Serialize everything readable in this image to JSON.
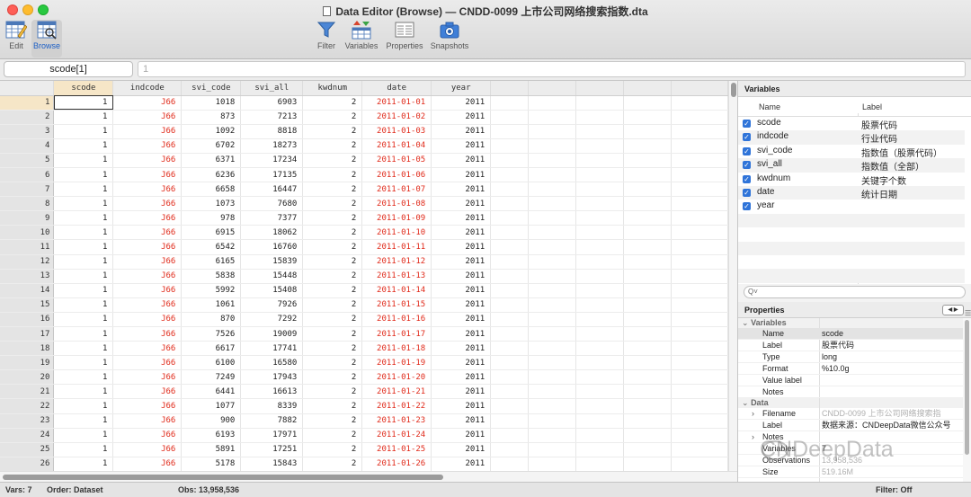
{
  "window": {
    "title": "Data Editor (Browse) — CNDD-0099 上市公司网络搜索指数.dta"
  },
  "toolbar": {
    "left": [
      {
        "label": "Edit",
        "icon": "edit-grid-icon"
      },
      {
        "label": "Browse",
        "icon": "browse-grid-icon"
      }
    ],
    "right": [
      {
        "label": "Filter",
        "icon": "funnel-icon"
      },
      {
        "label": "Variables",
        "icon": "variables-icon"
      },
      {
        "label": "Properties",
        "icon": "properties-icon"
      },
      {
        "label": "Snapshots",
        "icon": "camera-icon"
      }
    ]
  },
  "cell_editor": {
    "name": "scode[1]",
    "value": "1"
  },
  "grid": {
    "columns": [
      "scode",
      "indcode",
      "svi_code",
      "svi_all",
      "kwdnum",
      "date",
      "year"
    ],
    "rows": [
      [
        "1",
        "J66",
        "1018",
        "6903",
        "2",
        "2011-01-01",
        "2011"
      ],
      [
        "1",
        "J66",
        "873",
        "7213",
        "2",
        "2011-01-02",
        "2011"
      ],
      [
        "1",
        "J66",
        "1092",
        "8818",
        "2",
        "2011-01-03",
        "2011"
      ],
      [
        "1",
        "J66",
        "6702",
        "18273",
        "2",
        "2011-01-04",
        "2011"
      ],
      [
        "1",
        "J66",
        "6371",
        "17234",
        "2",
        "2011-01-05",
        "2011"
      ],
      [
        "1",
        "J66",
        "6236",
        "17135",
        "2",
        "2011-01-06",
        "2011"
      ],
      [
        "1",
        "J66",
        "6658",
        "16447",
        "2",
        "2011-01-07",
        "2011"
      ],
      [
        "1",
        "J66",
        "1073",
        "7680",
        "2",
        "2011-01-08",
        "2011"
      ],
      [
        "1",
        "J66",
        "978",
        "7377",
        "2",
        "2011-01-09",
        "2011"
      ],
      [
        "1",
        "J66",
        "6915",
        "18062",
        "2",
        "2011-01-10",
        "2011"
      ],
      [
        "1",
        "J66",
        "6542",
        "16760",
        "2",
        "2011-01-11",
        "2011"
      ],
      [
        "1",
        "J66",
        "6165",
        "15839",
        "2",
        "2011-01-12",
        "2011"
      ],
      [
        "1",
        "J66",
        "5838",
        "15448",
        "2",
        "2011-01-13",
        "2011"
      ],
      [
        "1",
        "J66",
        "5992",
        "15408",
        "2",
        "2011-01-14",
        "2011"
      ],
      [
        "1",
        "J66",
        "1061",
        "7926",
        "2",
        "2011-01-15",
        "2011"
      ],
      [
        "1",
        "J66",
        "870",
        "7292",
        "2",
        "2011-01-16",
        "2011"
      ],
      [
        "1",
        "J66",
        "7526",
        "19009",
        "2",
        "2011-01-17",
        "2011"
      ],
      [
        "1",
        "J66",
        "6617",
        "17741",
        "2",
        "2011-01-18",
        "2011"
      ],
      [
        "1",
        "J66",
        "6100",
        "16580",
        "2",
        "2011-01-19",
        "2011"
      ],
      [
        "1",
        "J66",
        "7249",
        "17943",
        "2",
        "2011-01-20",
        "2011"
      ],
      [
        "1",
        "J66",
        "6441",
        "16613",
        "2",
        "2011-01-21",
        "2011"
      ],
      [
        "1",
        "J66",
        "1077",
        "8339",
        "2",
        "2011-01-22",
        "2011"
      ],
      [
        "1",
        "J66",
        "900",
        "7882",
        "2",
        "2011-01-23",
        "2011"
      ],
      [
        "1",
        "J66",
        "6193",
        "17971",
        "2",
        "2011-01-24",
        "2011"
      ],
      [
        "1",
        "J66",
        "5891",
        "17251",
        "2",
        "2011-01-25",
        "2011"
      ],
      [
        "1",
        "J66",
        "5178",
        "15843",
        "2",
        "2011-01-26",
        "2011"
      ]
    ],
    "string_color": "#e02a1a"
  },
  "variables_panel": {
    "title": "Variables",
    "headers": {
      "name": "Name",
      "label": "Label"
    },
    "items": [
      {
        "name": "scode",
        "label": "股票代码",
        "checked": true
      },
      {
        "name": "indcode",
        "label": "行业代码",
        "checked": true
      },
      {
        "name": "svi_code",
        "label": "指数值（股票代码）",
        "checked": true
      },
      {
        "name": "svi_all",
        "label": "指数值（全部）",
        "checked": true
      },
      {
        "name": "kwdnum",
        "label": "关键字个数",
        "checked": true
      },
      {
        "name": "date",
        "label": "统计日期",
        "checked": true
      },
      {
        "name": "year",
        "label": "",
        "checked": true
      }
    ],
    "search_placeholder": "Q˅"
  },
  "properties_panel": {
    "title": "Properties",
    "variables_section": "Variables",
    "variables": [
      {
        "key": "Name",
        "value": "scode"
      },
      {
        "key": "Label",
        "value": "股票代码"
      },
      {
        "key": "Type",
        "value": "long"
      },
      {
        "key": "Format",
        "value": "%10.0g"
      },
      {
        "key": "Value label",
        "value": ""
      },
      {
        "key": "Notes",
        "value": ""
      }
    ],
    "data_section": "Data",
    "data": [
      {
        "key": "Filename",
        "value": "CNDD-0099 上市公司网络搜索指"
      },
      {
        "key": "Label",
        "value": "数据来源：CNDeepData微信公众号"
      },
      {
        "key": "Notes",
        "value": ""
      },
      {
        "key": "Variables",
        "value": "7"
      },
      {
        "key": "Observations",
        "value": "13,958,536"
      },
      {
        "key": "Size",
        "value": "519.16M"
      }
    ]
  },
  "watermark": "CNDeepData",
  "status": {
    "vars": "Vars: 7",
    "order": "Order: Dataset",
    "obs": "Obs: 13,958,536",
    "filter": "Filter: Off"
  }
}
